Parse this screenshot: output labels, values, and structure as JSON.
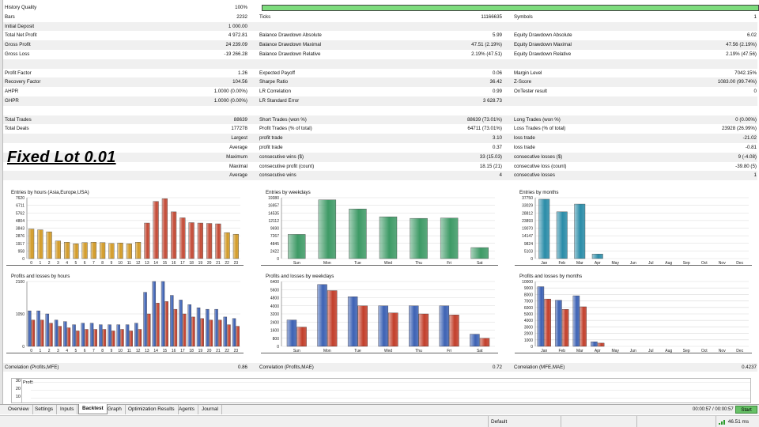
{
  "history_quality": {
    "label": "History Quality",
    "value": "100%",
    "fill": 1.0
  },
  "stats_rows": [
    [
      [
        "Bars",
        "2232"
      ],
      [
        "Ticks",
        "11166635"
      ],
      [
        "Symbols",
        "1"
      ]
    ],
    [
      [
        "Initial Deposit",
        "1 000.00"
      ],
      [
        "",
        ""
      ],
      [
        "",
        ""
      ]
    ],
    [
      [
        "Total Net Profit",
        "4 972.81"
      ],
      [
        "Balance Drawdown Absolute",
        "5.99"
      ],
      [
        "Equity Drawdown Absolute",
        "6.02"
      ]
    ],
    [
      [
        "Gross Profit",
        "24 239.09"
      ],
      [
        "Balance Drawdown Maximal",
        "47.51 (2.19%)"
      ],
      [
        "Equity Drawdown Maximal",
        "47.56 (2.19%)"
      ]
    ],
    [
      [
        "Gross Loss",
        "-19 266.28"
      ],
      [
        "Balance Drawdown Relative",
        "2.19% (47.51)"
      ],
      [
        "Equity Drawdown Relative",
        "2.19% (47.56)"
      ]
    ],
    [
      [
        "",
        ""
      ],
      [
        "",
        ""
      ],
      [
        "",
        ""
      ]
    ],
    [
      [
        "Profit Factor",
        "1.26"
      ],
      [
        "Expected Payoff",
        "0.06"
      ],
      [
        "Margin Level",
        "7042.15%"
      ]
    ],
    [
      [
        "Recovery Factor",
        "104.56"
      ],
      [
        "Sharpe Ratio",
        "36.42"
      ],
      [
        "Z-Score",
        "1083.00 (99.74%)"
      ]
    ],
    [
      [
        "AHPR",
        "1.0000 (0.00%)"
      ],
      [
        "LR Correlation",
        "0.99"
      ],
      [
        "OnTester result",
        "0"
      ]
    ],
    [
      [
        "GHPR",
        "1.0000 (0.00%)"
      ],
      [
        "LR Standard Error",
        "3 628.73"
      ],
      [
        "",
        ""
      ]
    ],
    [
      [
        "",
        ""
      ],
      [
        "",
        ""
      ],
      [
        "",
        ""
      ]
    ],
    [
      [
        "Total Trades",
        "88639"
      ],
      [
        "Short Trades (won %)",
        "88639 (73.01%)"
      ],
      [
        "Long Trades (won %)",
        "0 (0.00%)"
      ]
    ],
    [
      [
        "Total Deals",
        "177278"
      ],
      [
        "Profit Trades (% of total)",
        "64711 (73.01%)"
      ],
      [
        "Loss Trades (% of total)",
        "23928 (26.99%)"
      ]
    ],
    [
      [
        "",
        "Largest"
      ],
      [
        "profit trade",
        "3.10"
      ],
      [
        "loss trade",
        "-21.02"
      ]
    ],
    [
      [
        "",
        "Average"
      ],
      [
        "profit trade",
        "0.37"
      ],
      [
        "loss trade",
        "-0.81"
      ]
    ],
    [
      [
        "",
        "Maximum"
      ],
      [
        "consecutive wins ($)",
        "33 (15.03)"
      ],
      [
        "consecutive losses ($)",
        "9 (-4.08)"
      ]
    ],
    [
      [
        "",
        "Maximal"
      ],
      [
        "consecutive profit (count)",
        "18.15 (21)"
      ],
      [
        "consecutive loss (count)",
        "-39.80 (5)"
      ]
    ],
    [
      [
        "",
        "Average"
      ],
      [
        "consecutive wins",
        "4"
      ],
      [
        "consecutive losses",
        "1"
      ]
    ],
    [
      [
        "",
        ""
      ],
      [
        "",
        ""
      ],
      [
        "",
        ""
      ]
    ]
  ],
  "overlay_title": "Fixed Lot 0.01",
  "colors": {
    "hours": "#d29a26",
    "hours_red": "#c34a35",
    "weekdays": "#3e9a66",
    "months": "#2a8ca8",
    "blue": "#3d62b4",
    "red": "#c23f2b",
    "grid": "#d9d9d9"
  },
  "charts": {
    "hours": {
      "title": "Entries by hours (Asia,Europe,USA)",
      "yticks": [
        "7620",
        "6711",
        "5762",
        "4804",
        "3843",
        "2876",
        "1917",
        "958",
        "0"
      ],
      "ymax": 7620,
      "categories": [
        "0",
        "1",
        "2",
        "3",
        "4",
        "5",
        "6",
        "7",
        "8",
        "9",
        "10",
        "11",
        "12",
        "13",
        "14",
        "15",
        "16",
        "17",
        "18",
        "19",
        "20",
        "21",
        "22",
        "23"
      ],
      "values": [
        3700,
        3600,
        3350,
        2200,
        2050,
        1850,
        2000,
        2050,
        2000,
        1900,
        1950,
        1850,
        2050,
        4450,
        7150,
        7500,
        5850,
        5100,
        4500,
        4450,
        4400,
        4350,
        3250,
        3050
      ]
    },
    "weekdays": {
      "title": "Entries by weekdays",
      "yticks": [
        "19380",
        "16957",
        "14535",
        "12112",
        "9690",
        "7267",
        "4845",
        "2422",
        "0"
      ],
      "ymax": 19380,
      "categories": [
        "Sun",
        "Mon",
        "Tue",
        "Wed",
        "Thu",
        "Fri",
        "Sat"
      ],
      "values": [
        7700,
        18700,
        15800,
        13300,
        12800,
        12900,
        3500
      ]
    },
    "months": {
      "title": "Entries by months",
      "yticks": [
        "37750",
        "33029",
        "28812",
        "23893",
        "19070",
        "14147",
        "9824",
        "5103",
        "0"
      ],
      "ymax": 37750,
      "categories": [
        "Jan",
        "Feb",
        "Mar",
        "Apr",
        "May",
        "Jun",
        "Jul",
        "Aug",
        "Sep",
        "Oct",
        "Nov",
        "Dec"
      ],
      "values": [
        36800,
        29000,
        33800,
        2800,
        0,
        0,
        0,
        0,
        0,
        0,
        0,
        0
      ]
    },
    "pl_hours": {
      "title": "Profits and losses by hours",
      "yticks": [
        "2100",
        "1050",
        "0"
      ],
      "ymax": 2100,
      "categories": [
        "0",
        "1",
        "2",
        "3",
        "4",
        "5",
        "6",
        "7",
        "8",
        "9",
        "10",
        "11",
        "12",
        "13",
        "14",
        "15",
        "16",
        "17",
        "18",
        "19",
        "20",
        "21",
        "22",
        "23"
      ],
      "profits": [
        1150,
        1150,
        1050,
        850,
        800,
        700,
        750,
        750,
        700,
        700,
        700,
        700,
        750,
        1750,
        2100,
        2100,
        1650,
        1500,
        1350,
        1250,
        1200,
        1200,
        950,
        900
      ],
      "losses": [
        850,
        850,
        750,
        650,
        600,
        500,
        550,
        550,
        550,
        500,
        550,
        500,
        550,
        1050,
        1400,
        1450,
        1200,
        1050,
        950,
        900,
        850,
        850,
        700,
        650
      ]
    },
    "pl_weekdays": {
      "title": "Profits and losses by weekdays",
      "yticks": [
        "6400",
        "5600",
        "4800",
        "4000",
        "3200",
        "2400",
        "1600",
        "800",
        "0"
      ],
      "ymax": 6400,
      "categories": [
        "Sun",
        "Mon",
        "Tue",
        "Wed",
        "Thu",
        "Fri",
        "Sat"
      ],
      "profits": [
        2600,
        6100,
        4900,
        4000,
        4000,
        4000,
        1200
      ],
      "losses": [
        1900,
        5500,
        4000,
        3300,
        3200,
        3100,
        800
      ]
    },
    "pl_months": {
      "title": "Profits and losses by months",
      "yticks": [
        "10000",
        "9000",
        "8000",
        "7000",
        "6000",
        "5000",
        "4000",
        "3000",
        "2000",
        "1000",
        "0"
      ],
      "ymax": 10000,
      "categories": [
        "Jan",
        "Feb",
        "Mar",
        "Apr",
        "May",
        "Jun",
        "Jul",
        "Aug",
        "Sep",
        "Oct",
        "Nov",
        "Dec"
      ],
      "profits": [
        9200,
        7100,
        7800,
        700,
        0,
        0,
        0,
        0,
        0,
        0,
        0,
        0
      ],
      "losses": [
        7300,
        5700,
        6100,
        500,
        0,
        0,
        0,
        0,
        0,
        0,
        0,
        0
      ]
    }
  },
  "correlations": [
    [
      "Correlation (Profits,MFE)",
      "0.86"
    ],
    [
      "Correlation (Profits,MAE)",
      "0.72"
    ],
    [
      "Correlation (MFE,MAE)",
      "0.4237"
    ]
  ],
  "profit_chart": {
    "title": "Profit",
    "yticks": [
      "30",
      "20",
      "10"
    ]
  },
  "tabs": [
    "Overview",
    "Settings",
    "Inputs",
    "Backtest",
    "Graph",
    "Optimization Results",
    "Agents",
    "Journal"
  ],
  "active_tab": "Backtest",
  "elapsed": "00:00:57 / 00:00:57",
  "start_label": "Start",
  "status": {
    "profile": "Default",
    "ping": "46.51 ms"
  }
}
